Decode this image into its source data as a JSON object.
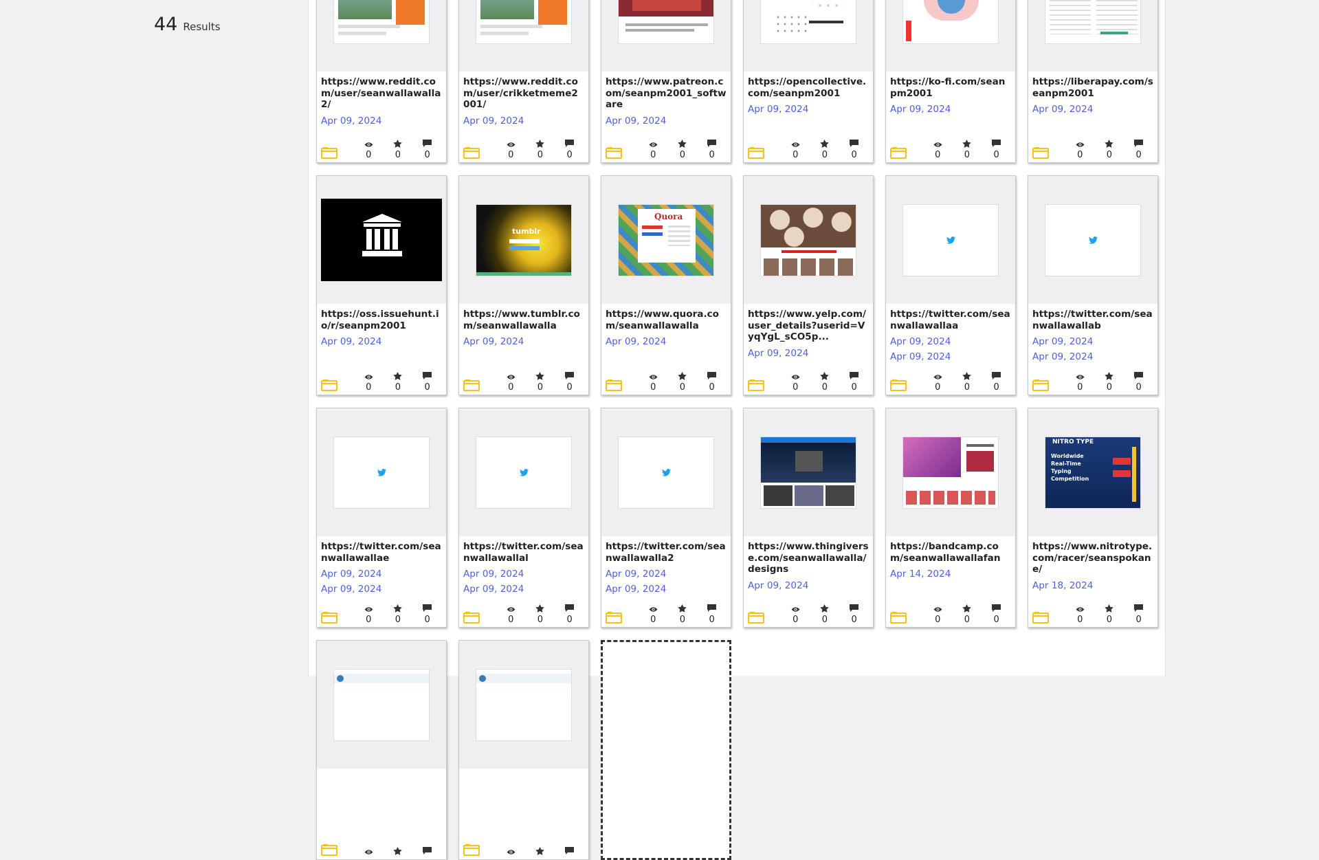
{
  "results": {
    "count": "44",
    "label": "Results"
  },
  "colors": {
    "accent_date": "#4c5fdd",
    "folder_icon": "#f4c21a"
  },
  "cards": [
    {
      "url": "https://www.reddit.com/user/seanwallawalla2/",
      "dates": [
        "Apr 09, 2024"
      ],
      "thumb": "reddit",
      "views": "0",
      "stars": "0",
      "comments": "0"
    },
    {
      "url": "https://www.reddit.com/user/crikketmeme2001/",
      "dates": [
        "Apr 09, 2024"
      ],
      "thumb": "reddit",
      "views": "0",
      "stars": "0",
      "comments": "0"
    },
    {
      "url": "https://www.patreon.com/seanpm2001_software",
      "dates": [
        "Apr 09, 2024"
      ],
      "thumb": "patreon",
      "views": "0",
      "stars": "0",
      "comments": "0"
    },
    {
      "url": "https://opencollective.com/seanpm2001",
      "dates": [
        "Apr 09, 2024"
      ],
      "thumb": "opencollective",
      "views": "0",
      "stars": "0",
      "comments": "0"
    },
    {
      "url": "https://ko-fi.com/seanpm2001",
      "dates": [
        "Apr 09, 2024"
      ],
      "thumb": "kofi",
      "views": "0",
      "stars": "0",
      "comments": "0"
    },
    {
      "url": "https://liberapay.com/seanpm2001",
      "dates": [
        "Apr 09, 2024"
      ],
      "thumb": "liberapay",
      "views": "0",
      "stars": "0",
      "comments": "0"
    },
    {
      "url": "https://oss.issuehunt.io/r/seanpm2001",
      "dates": [
        "Apr 09, 2024"
      ],
      "thumb": "archive",
      "views": "0",
      "stars": "0",
      "comments": "0"
    },
    {
      "url": "https://www.tumblr.com/seanwallawalla",
      "dates": [
        "Apr 09, 2024"
      ],
      "thumb": "tumblr",
      "views": "0",
      "stars": "0",
      "comments": "0"
    },
    {
      "url": "https://www.quora.com/seanwallawalla",
      "dates": [
        "Apr 09, 2024"
      ],
      "thumb": "quora",
      "views": "0",
      "stars": "0",
      "comments": "0"
    },
    {
      "url": "https://www.yelp.com/user_details?userid=VyqYgL_sCO5p...",
      "dates": [
        "Apr 09, 2024"
      ],
      "thumb": "yelp",
      "views": "0",
      "stars": "0",
      "comments": "0"
    },
    {
      "url": "https://twitter.com/seanwallawallaa",
      "dates": [
        "Apr 09, 2024",
        "Apr 09, 2024"
      ],
      "thumb": "twitter",
      "views": "0",
      "stars": "0",
      "comments": "0"
    },
    {
      "url": "https://twitter.com/seanwallawallab",
      "dates": [
        "Apr 09, 2024",
        "Apr 09, 2024"
      ],
      "thumb": "twitter",
      "views": "0",
      "stars": "0",
      "comments": "0"
    },
    {
      "url": "https://twitter.com/seanwallawallae",
      "dates": [
        "Apr 09, 2024",
        "Apr 09, 2024"
      ],
      "thumb": "twitter",
      "views": "0",
      "stars": "0",
      "comments": "0"
    },
    {
      "url": "https://twitter.com/seanwallawallal",
      "dates": [
        "Apr 09, 2024",
        "Apr 09, 2024"
      ],
      "thumb": "twitter",
      "views": "0",
      "stars": "0",
      "comments": "0"
    },
    {
      "url": "https://twitter.com/seanwallawalla2",
      "dates": [
        "Apr 09, 2024",
        "Apr 09, 2024"
      ],
      "thumb": "twitter",
      "views": "0",
      "stars": "0",
      "comments": "0"
    },
    {
      "url": "https://www.thingiverse.com/seanwallawalla/designs",
      "dates": [
        "Apr 09, 2024"
      ],
      "thumb": "thingiverse",
      "views": "0",
      "stars": "0",
      "comments": "0"
    },
    {
      "url": "https://bandcamp.com/seanwallawallafan",
      "dates": [
        "Apr 14, 2024"
      ],
      "thumb": "bandcamp",
      "views": "0",
      "stars": "0",
      "comments": "0"
    },
    {
      "url": "https://www.nitrotype.com/racer/seanspokane/",
      "dates": [
        "Apr 18, 2024"
      ],
      "thumb": "nitrotype",
      "views": "0",
      "stars": "0",
      "comments": "0"
    },
    {
      "url": "",
      "dates": [],
      "thumb": "steam",
      "views": "",
      "stars": "",
      "comments": ""
    },
    {
      "url": "",
      "dates": [],
      "thumb": "steam",
      "views": "",
      "stars": "",
      "comments": ""
    },
    {
      "placeholder": true
    }
  ]
}
